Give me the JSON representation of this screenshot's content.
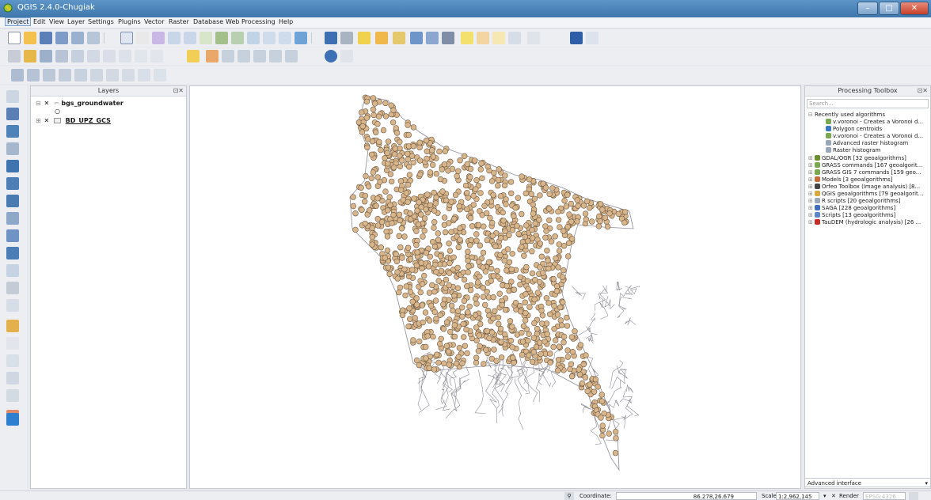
{
  "window": {
    "title": "QGIS 2.4.0-Chugiak",
    "min": "–",
    "max": "□",
    "close": "✕"
  },
  "menu": [
    "Project",
    "Edit",
    "View",
    "Layer",
    "Settings",
    "Plugins",
    "Vector",
    "Raster",
    "Database",
    "Web",
    "Processing",
    "Help"
  ],
  "layers_panel": {
    "title": "Layers",
    "layers": [
      {
        "name": "bgs_groundwater",
        "symbol": "○"
      },
      {
        "name": "BD_UPZ_GCS"
      }
    ]
  },
  "toolbox": {
    "title": "Processing Toolbox",
    "search_placeholder": "Search...",
    "recent_header": "Recently used algorithms",
    "recent": [
      "v.voronoi - Creates a Voronoi d...",
      "Polygon centroids",
      "v.voronoi - Creates a Voronoi d...",
      "Advanced raster histogram",
      "Raster histogram"
    ],
    "providers": [
      "GDAL/OGR [32 geoalgorithms]",
      "GRASS commands [167 geoalgorit...",
      "GRASS GIS 7 commands [159 geo...",
      "Models [3 geoalgorithms]",
      "Orfeo Toolbox (Image analysis) [8...",
      "QGIS geoalgorithms [79 geoalgorit...",
      "R scripts [20 geoalgorithms]",
      "SAGA [228 geoalgorithms]",
      "Scripts [13 geoalgorithms]",
      "TauDEM (hydrologic analysis) [26 ..."
    ],
    "advanced": "Advanced interface"
  },
  "status": {
    "coord_label": "Coordinate:",
    "coord_value": "86.278,26.679",
    "scale_label": "Scale",
    "scale_value": "1:2,962,145",
    "render_label": "Render",
    "epsg": "EPSG:4326"
  },
  "colors": {
    "point_fill": "#d9b58c",
    "point_stroke": "#6d5a40",
    "boundary": "#8c8c96",
    "titlebar": "#4a83b9"
  }
}
